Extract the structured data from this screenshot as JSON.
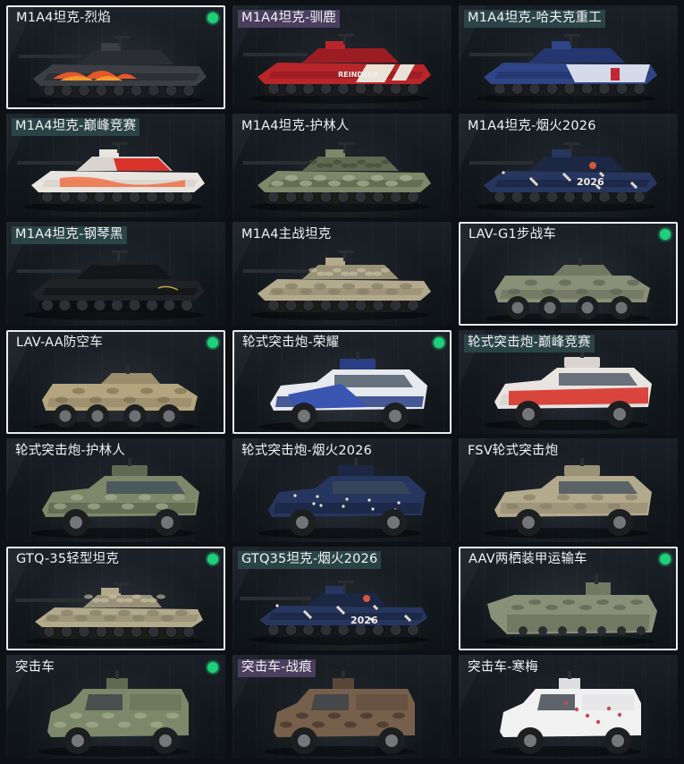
{
  "vehicles": [
    {
      "name": "M1A4坦克-烈焰",
      "kind": "tank",
      "camo": "flame",
      "selected": true,
      "owned": true,
      "tag": "none"
    },
    {
      "name": "M1A4坦克-驯鹿",
      "kind": "tank",
      "camo": "reindeer",
      "selected": false,
      "owned": false,
      "tag": "purple",
      "decal": "REINDEER"
    },
    {
      "name": "M1A4坦克-哈夫克重工",
      "kind": "tank",
      "camo": "haavk",
      "selected": false,
      "owned": false,
      "tag": "teal"
    },
    {
      "name": "M1A4坦克-巅峰竞赛",
      "kind": "tank",
      "camo": "peak",
      "selected": false,
      "owned": false,
      "tag": "teal"
    },
    {
      "name": "M1A4坦克-护林人",
      "kind": "tank",
      "camo": "forest",
      "selected": false,
      "owned": false,
      "tag": "none"
    },
    {
      "name": "M1A4坦克-烟火2026",
      "kind": "tank",
      "camo": "firework",
      "selected": false,
      "owned": false,
      "tag": "none",
      "decal": "2026"
    },
    {
      "name": "M1A4坦克-钢琴黑",
      "kind": "tank",
      "camo": "black",
      "selected": false,
      "owned": false,
      "tag": "teal"
    },
    {
      "name": "M1A4主战坦克",
      "kind": "tank",
      "camo": "desert",
      "selected": false,
      "owned": false,
      "tag": "none"
    },
    {
      "name": "LAV-G1步战车",
      "kind": "lav",
      "camo": "drab",
      "selected": true,
      "owned": true,
      "tag": "none"
    },
    {
      "name": "LAV-AA防空车",
      "kind": "lav",
      "camo": "sand",
      "selected": true,
      "owned": true,
      "tag": "none"
    },
    {
      "name": "轮式突击炮-荣耀",
      "kind": "wheeled",
      "camo": "glory",
      "selected": true,
      "owned": true,
      "tag": "none"
    },
    {
      "name": "轮式突击炮-巅峰竞赛",
      "kind": "wheeled",
      "camo": "peak",
      "selected": false,
      "owned": false,
      "tag": "teal"
    },
    {
      "name": "轮式突击炮-护林人",
      "kind": "wheeled",
      "camo": "forest",
      "selected": false,
      "owned": false,
      "tag": "none"
    },
    {
      "name": "轮式突击炮-烟火2026",
      "kind": "wheeled",
      "camo": "firework",
      "selected": false,
      "owned": false,
      "tag": "none"
    },
    {
      "name": "FSV轮式突击炮",
      "kind": "wheeled",
      "camo": "desert",
      "selected": false,
      "owned": false,
      "tag": "none"
    },
    {
      "name": "GTQ-35轻型坦克",
      "kind": "light",
      "camo": "desert",
      "selected": true,
      "owned": true,
      "tag": "none"
    },
    {
      "name": "GTQ35坦克-烟火2026",
      "kind": "light",
      "camo": "firework",
      "selected": false,
      "owned": false,
      "tag": "teal",
      "decal": "2026"
    },
    {
      "name": "AAV两栖装甲运输车",
      "kind": "aav",
      "camo": "drab",
      "selected": true,
      "owned": true,
      "tag": "none"
    },
    {
      "name": "突击车",
      "kind": "mrap",
      "camo": "forest",
      "selected": false,
      "owned": true,
      "tag": "none"
    },
    {
      "name": "突击车-战痕",
      "kind": "mrap",
      "camo": "rust",
      "selected": false,
      "owned": false,
      "tag": "purple"
    },
    {
      "name": "突击车-寒梅",
      "kind": "mrap",
      "camo": "plum",
      "selected": false,
      "owned": false,
      "tag": "none"
    }
  ],
  "colors": {
    "selected_border": "#e9edf1",
    "owned_indicator": "#1ed07a",
    "tag_purple": "#524468",
    "tag_teal": "#2e4a4c"
  }
}
